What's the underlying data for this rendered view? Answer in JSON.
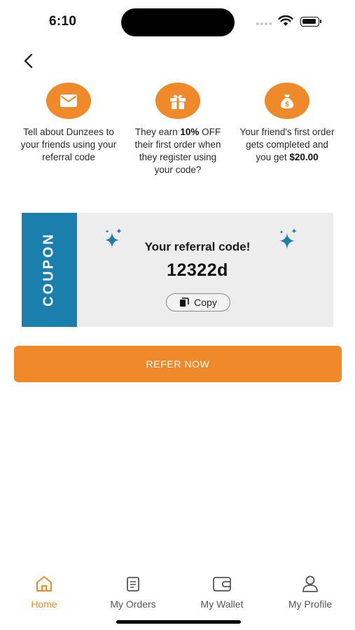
{
  "status_bar": {
    "time": "6:10"
  },
  "steps": [
    {
      "icon": "envelope-icon",
      "parts": [
        {
          "text": "Tell about Dunzees to your friends using your referral code",
          "bold": false
        }
      ]
    },
    {
      "icon": "gift-icon",
      "parts": [
        {
          "text": "They earn ",
          "bold": false
        },
        {
          "text": "10%",
          "bold": true
        },
        {
          "text": " OFF their first order when they register using your code?",
          "bold": false
        }
      ]
    },
    {
      "icon": "money-bag-icon",
      "parts": [
        {
          "text": "Your friend's first order gets completed and you get ",
          "bold": false
        },
        {
          "text": "$20.00",
          "bold": true
        }
      ]
    }
  ],
  "coupon": {
    "label": "COUPON",
    "title": "Your referral code!",
    "code": "12322d",
    "copy_label": "Copy"
  },
  "refer_button": {
    "label": "REFER NOW"
  },
  "bottom_nav": [
    {
      "label": "Home",
      "icon": "home-icon",
      "active": true
    },
    {
      "label": "My Orders",
      "icon": "orders-icon",
      "active": false
    },
    {
      "label": "My Wallet",
      "icon": "wallet-icon",
      "active": false
    },
    {
      "label": "My Profile",
      "icon": "profile-icon",
      "active": false
    }
  ],
  "colors": {
    "accent": "#F0892A",
    "coupon_blue": "#1B7FAE",
    "coupon_bg": "#EDEDED"
  }
}
